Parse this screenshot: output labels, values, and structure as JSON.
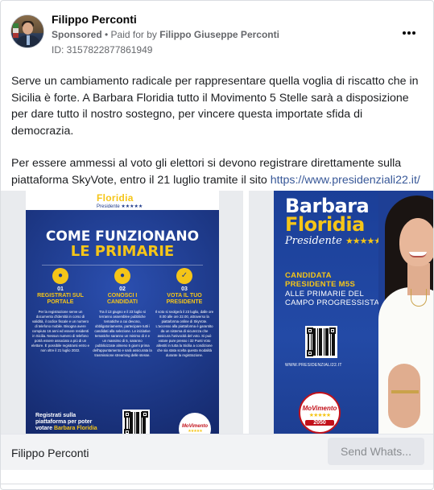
{
  "post": {
    "author": "Filippo Perconti",
    "sponsored": "Sponsored",
    "paid_for_prefix": "• Paid for by",
    "payer": "Filippo Giuseppe Perconti",
    "ad_id": "ID: 3157822877861949",
    "more_icon": "more-horizontal-icon",
    "paragraph1": "Serve un cambiamento radicale per rappresentare quella voglia di riscatto che in Sicilia è forte. A Barbara Floridia tutto il Movimento 5 Stelle sarà a disposizione per dare tutto il nostro sostegno, per vincere questa importate sfida di democrazia.",
    "paragraph2_prefix": "Per essere ammessi al voto gli elettori si devono registrare direttamente sulla piattaforma SkyVote, entro il 21 luglio tramite il sito ",
    "paragraph2_link": "https://www.presidenziali22.it/",
    "ellipsis": "…"
  },
  "slides": [
    {
      "brand": "Floridia",
      "brand_sub": "Presidente ★★★★★",
      "title_line1": "COME FUNZIONANO",
      "title_line2": "LE PRIMARIE",
      "steps": [
        {
          "num": "01",
          "title": "REGISTRATI SUL PORTALE",
          "text": "Per la registrazione serve un documento d'identità in corso di validità, il codice fiscale e un numero di telefono mobile. Bisogna avere compiuto 16 anni ed essere residenti in Sicilia. Nessun numero di telefono potrà essere associato a più di un elettore. È possibile registrarsi entro e non oltre il 21 luglio 2022."
        },
        {
          "num": "02",
          "title": "CONOSCI I CANDIDATI",
          "text": "Tra il 13 giugno e il 23 luglio si terranno assemblee pubbliche tematiche a cui devono, obbligatoriamente, partecipare tutti i candidati alla selezione. Le iniziative tematiche saranno un minimo di 4 e un massimo di 5, saranno pubblicizzate almeno 5 giorni prima dell'appuntamento e sarà assicurata la trasmissione streaming delle stesse."
        },
        {
          "num": "03",
          "title": "VOTA IL TUO PRESIDENTE",
          "text": "Il voto si svolgerà il 23 luglio, dalle ore 8.00 alle ore 22.00, attraverso la piattaforma online di SkyVote. L'accesso alla piattaforma è garantito da un sistema di sicurezza che assicura l'univocità del voto. Si può votare pure presso i 32 Punti Voto allestiti in tutta la Sicilia a condizione che sia stata scelta questa modalità durante la registrazione."
        }
      ],
      "footer_text": "Registrati sulla piattaforma per poter votare",
      "footer_name": "Barbara Floridia",
      "badge_word": "MoVimento",
      "badge_stars": "★★★★★"
    },
    {
      "name_first": "Barbara",
      "name_last": "Floridia",
      "role": "Presidente",
      "role_stars": "★★★★★",
      "candidacy": "CANDIDATA PRESIDENTE M5S",
      "primaries": "ALLE PRIMARIE DEL CAMPO PROGRESSISTA",
      "site": "WWW.PRESIDENZIALI22.IT",
      "badge_word": "MoVimento",
      "badge_stars": "★★★★★",
      "badge_year": "2050"
    }
  ],
  "carousel": {
    "next_icon": "chevron-right-icon"
  },
  "footer": {
    "name": "Filippo Perconti",
    "cta": "Send Whats..."
  }
}
